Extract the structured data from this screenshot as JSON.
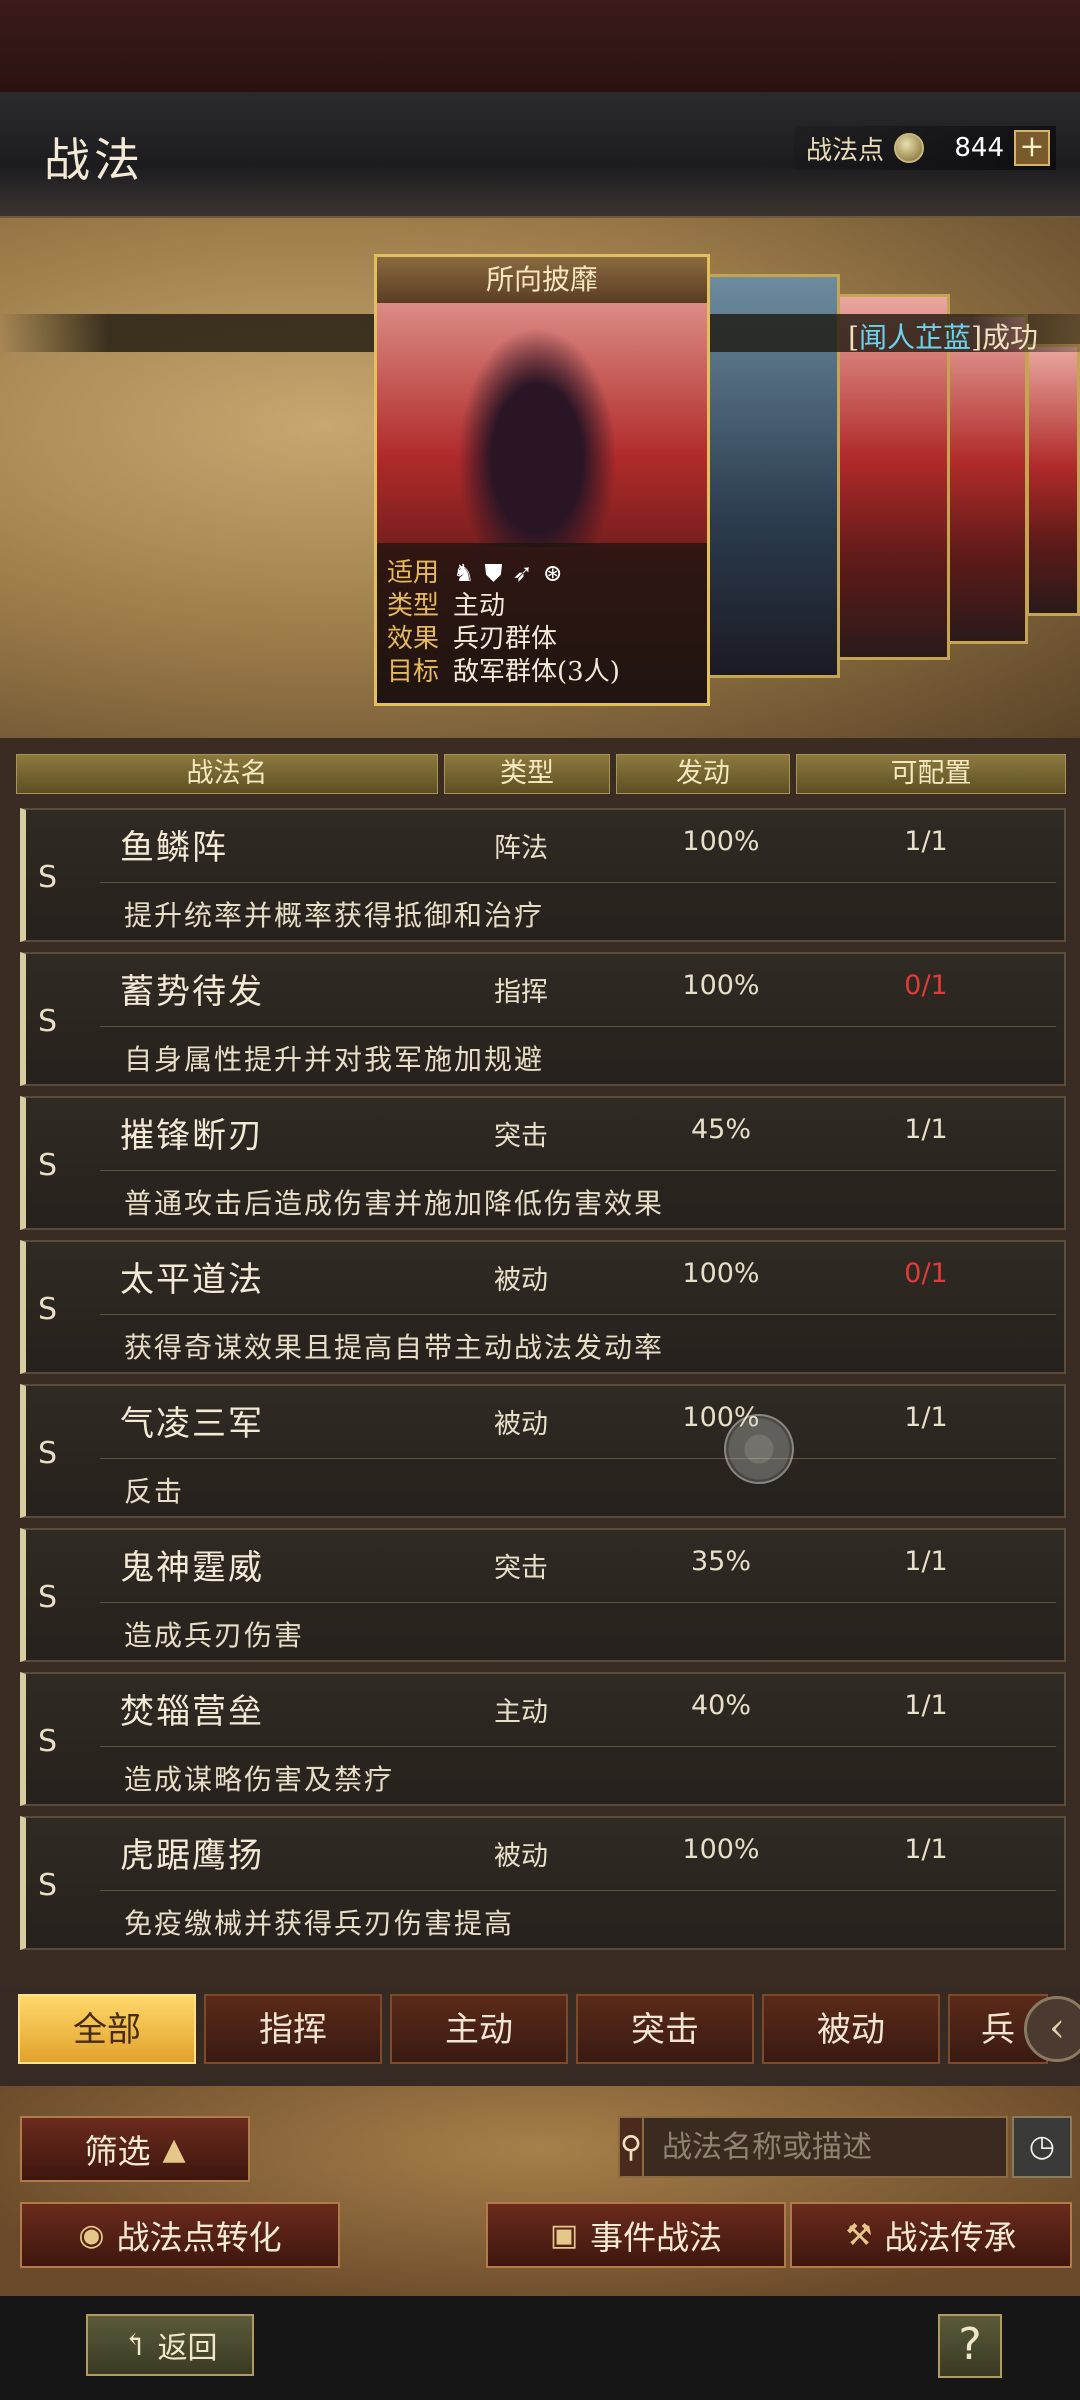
{
  "header": {
    "title": "战法",
    "points_label": "战法点",
    "points_value": "844",
    "plus_label": "+"
  },
  "notice": {
    "prefix": "[",
    "name": "闻人芷蓝",
    "suffix": "]成功"
  },
  "featured_card": {
    "name": "所向披靡",
    "rows": [
      {
        "key": "适用",
        "value": ""
      },
      {
        "key": "类型",
        "value": "主动"
      },
      {
        "key": "效果",
        "value": "兵刃群体"
      },
      {
        "key": "目标",
        "value": "敌军群体(3人)"
      }
    ],
    "applicable_icons": [
      "cavalry-icon",
      "shield-icon",
      "bow-icon",
      "wheel-icon"
    ]
  },
  "table": {
    "headers": [
      "战法名",
      "类型",
      "发动",
      "可配置"
    ],
    "rows": [
      {
        "grade": "S",
        "name": "鱼鳞阵",
        "type": "阵法",
        "rate": "100%",
        "config": "1/1",
        "config_red": false,
        "desc": "提升统率并概率获得抵御和治疗"
      },
      {
        "grade": "S",
        "name": "蓄势待发",
        "type": "指挥",
        "rate": "100%",
        "config": "0/1",
        "config_red": true,
        "desc": "自身属性提升并对我军施加规避"
      },
      {
        "grade": "S",
        "name": "摧锋断刃",
        "type": "突击",
        "rate": "45%",
        "config": "1/1",
        "config_red": false,
        "desc": "普通攻击后造成伤害并施加降低伤害效果"
      },
      {
        "grade": "S",
        "name": "太平道法",
        "type": "被动",
        "rate": "100%",
        "config": "0/1",
        "config_red": true,
        "desc": "获得奇谋效果且提高自带主动战法发动率"
      },
      {
        "grade": "S",
        "name": "气凌三军",
        "type": "被动",
        "rate": "100%",
        "config": "1/1",
        "config_red": false,
        "desc": "反击"
      },
      {
        "grade": "S",
        "name": "鬼神霆威",
        "type": "突击",
        "rate": "35%",
        "config": "1/1",
        "config_red": false,
        "desc": "造成兵刃伤害"
      },
      {
        "grade": "S",
        "name": "焚辎营垒",
        "type": "主动",
        "rate": "40%",
        "config": "1/1",
        "config_red": false,
        "desc": "造成谋略伤害及禁疗"
      },
      {
        "grade": "S",
        "name": "虎踞鹰扬",
        "type": "被动",
        "rate": "100%",
        "config": "1/1",
        "config_red": false,
        "desc": "免疫缴械并获得兵刃伤害提高"
      }
    ]
  },
  "tabs": [
    "全部",
    "指挥",
    "主动",
    "突击",
    "被动",
    "兵"
  ],
  "controls": {
    "filter_label": "筛选",
    "search_placeholder": "战法名称或描述",
    "convert_label": "战法点转化",
    "event_label": "事件战法",
    "inherit_label": "战法传承",
    "back_label": "返回",
    "help_label": "?"
  },
  "colors": {
    "active_tab": "#f0b840",
    "config_red": "#e23a3a",
    "notice_name": "#6ad4f0"
  }
}
